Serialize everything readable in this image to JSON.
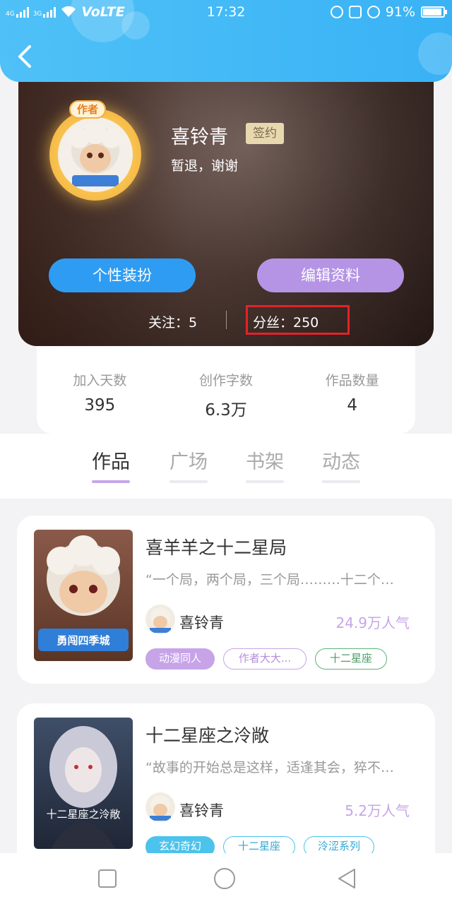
{
  "status_bar": {
    "network_left": "4G",
    "network_right": "3G",
    "volte": "VoLTE",
    "time": "17:32",
    "battery": "91%"
  },
  "profile": {
    "author_badge": "作者",
    "name": "喜铃青",
    "signed_badge": "签约",
    "motto": "暂退，谢谢",
    "btn_dressup": "个性装扮",
    "btn_edit": "编辑资料",
    "follow": "关注：5",
    "fans": "分丝：250"
  },
  "stats": [
    {
      "label": "加入天数",
      "value": "395"
    },
    {
      "label": "创作字数",
      "value": "6.3万"
    },
    {
      "label": "作品数量",
      "value": "4"
    }
  ],
  "tabs": [
    {
      "label": "作品",
      "active": true
    },
    {
      "label": "广场",
      "active": false
    },
    {
      "label": "书架",
      "active": false
    },
    {
      "label": "动态",
      "active": false
    }
  ],
  "books": [
    {
      "title": "喜羊羊之十二星局",
      "desc": "“一个局，两个局，三个局………十二个…",
      "author": "喜铃青",
      "popularity": "24.9万人气",
      "cover_text": "勇闯四季城",
      "tags": [
        "动漫同人",
        "作者大大...",
        "十二星座"
      ]
    },
    {
      "title": "十二星座之泠敞",
      "desc": "“故事的开始总是这样，适逢其会，猝不…",
      "author": "喜铃青",
      "popularity": "5.2万人气",
      "cover_text": "十二星座之泠敞",
      "tags": [
        "玄幻奇幻",
        "十二星座",
        "泠涩系列"
      ]
    }
  ],
  "icons": [
    "back-arrow-icon",
    "wifi-icon",
    "alarm-icon",
    "lock-icon",
    "battery-icon",
    "square-nav-icon",
    "circle-nav-icon",
    "triangle-back-nav-icon"
  ],
  "colors": {
    "header_blue": "#3eb6f6",
    "accent_purple": "#b594e5",
    "accent_blue_button": "#2e9cf2",
    "highlight_red": "#e3222a"
  }
}
